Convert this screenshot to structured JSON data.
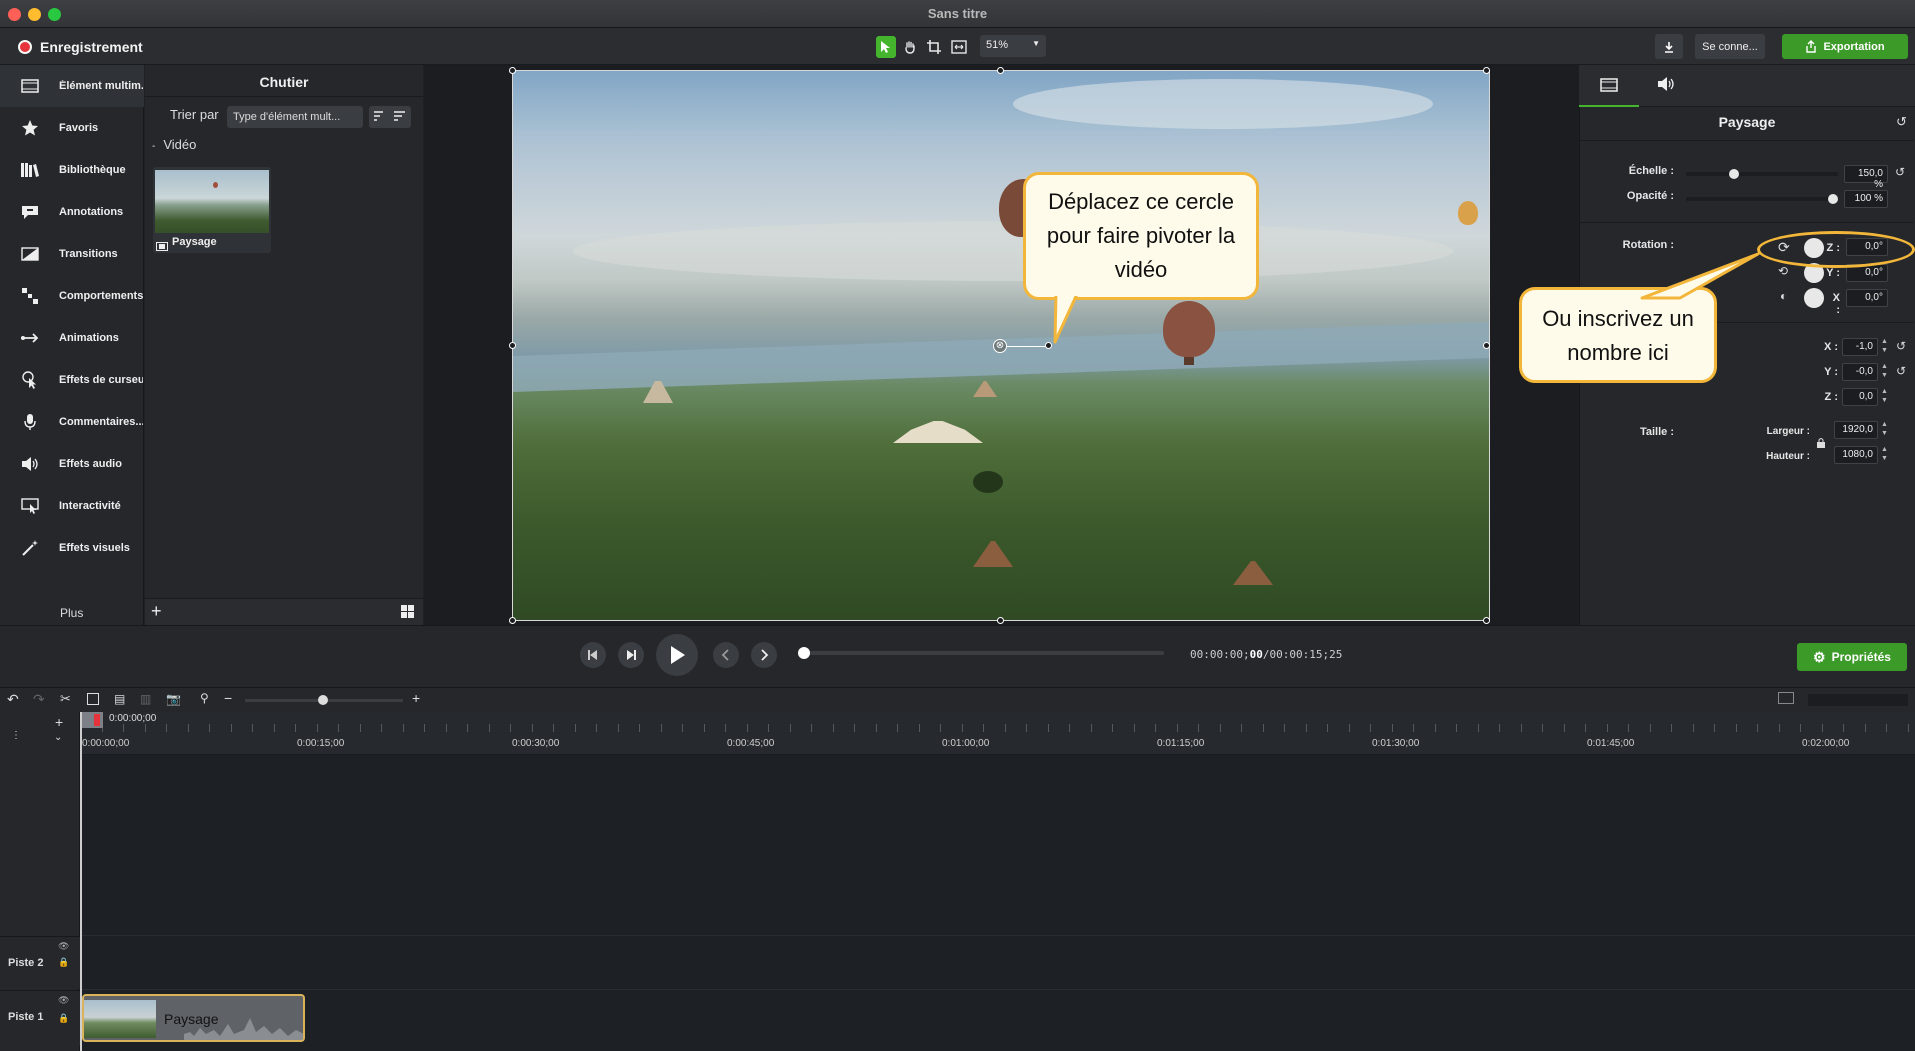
{
  "window": {
    "title": "Sans titre"
  },
  "toolbar": {
    "record_label": "Enregistrement",
    "zoom": "51%",
    "connect_label": "Se conne...",
    "export_label": "Exportation"
  },
  "sidebar": {
    "items": [
      {
        "label": "Élément multim...",
        "icon": "film-icon"
      },
      {
        "label": "Favoris",
        "icon": "star-icon"
      },
      {
        "label": "Bibliothèque",
        "icon": "library-icon"
      },
      {
        "label": "Annotations",
        "icon": "annotation-icon"
      },
      {
        "label": "Transitions",
        "icon": "transition-icon"
      },
      {
        "label": "Comportements",
        "icon": "behavior-icon"
      },
      {
        "label": "Animations",
        "icon": "animation-icon"
      },
      {
        "label": "Effets de curseur",
        "icon": "cursor-icon"
      },
      {
        "label": "Commentaires...",
        "icon": "microphone-icon"
      },
      {
        "label": "Effets audio",
        "icon": "speaker-icon"
      },
      {
        "label": "Interactivité",
        "icon": "interactivity-icon"
      },
      {
        "label": "Effets visuels",
        "icon": "magic-wand-icon"
      }
    ],
    "more_label": "Plus"
  },
  "bin": {
    "title": "Chutier",
    "sort_label": "Trier par",
    "sort_value": "Type d'élément mult...",
    "section_label": "Vidéo",
    "clip_name": "Paysage"
  },
  "callouts": {
    "rotate": "Déplacez ce cercle pour faire pivoter la vidéo",
    "type_number": "Ou inscrivez un nombre ici"
  },
  "properties": {
    "title": "Paysage",
    "scale_label": "Échelle :",
    "scale_value": "150,0 %",
    "scale_fraction": 0.3,
    "opacity_label": "Opacité :",
    "opacity_value": "100 %",
    "opacity_fraction": 1.0,
    "rotation_label": "Rotation :",
    "rotation": {
      "z_label": "Z :",
      "z_value": "0,0°",
      "y_label": "Y :",
      "y_value": "0,0°",
      "x_label": "X :",
      "x_value": "0,0°"
    },
    "position": {
      "x_label": "X :",
      "x_value": "-1,0",
      "y_label": "Y :",
      "y_value": "-0,0",
      "z_label": "Z :",
      "z_value": "0,0"
    },
    "size_label": "Taille :",
    "width_label": "Largeur :",
    "width_value": "1920,0",
    "height_label": "Hauteur :",
    "height_value": "1080,0"
  },
  "playback": {
    "timecode_current": "00:00:00;",
    "timecode_frame": "00",
    "timecode_total": "/00:00:15;25",
    "properties_label": "Propriétés"
  },
  "timeline": {
    "playhead_time": "0:00:00;00",
    "ticks": [
      "0:00:00;00",
      "0:00:15;00",
      "0:00:30;00",
      "0:00:45;00",
      "0:01:00;00",
      "0:01:15;00",
      "0:01:30;00",
      "0:01:45;00",
      "0:02:00;00"
    ],
    "tracks": [
      {
        "label": "Piste 2"
      },
      {
        "label": "Piste 1",
        "clip": "Paysage"
      }
    ]
  },
  "colors": {
    "accent_green": "#3c9a28",
    "callout_border": "#f2b63a",
    "record_red": "#e7343c"
  }
}
